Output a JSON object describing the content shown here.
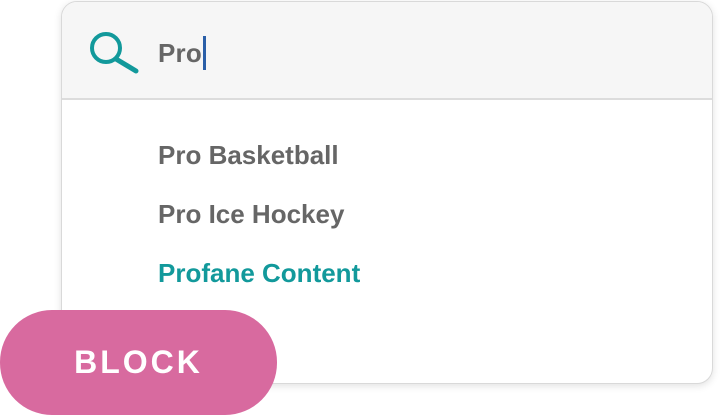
{
  "search": {
    "icon": "search-icon",
    "value": "Pro",
    "accent_color": "#12999b"
  },
  "suggestions": [
    {
      "label": "Pro Basketball",
      "active": false
    },
    {
      "label": "Pro Ice Hockey",
      "active": false
    },
    {
      "label": "Profane Content",
      "active": true
    }
  ],
  "block_button": {
    "label": "BLOCK",
    "color": "#d86a9f"
  }
}
